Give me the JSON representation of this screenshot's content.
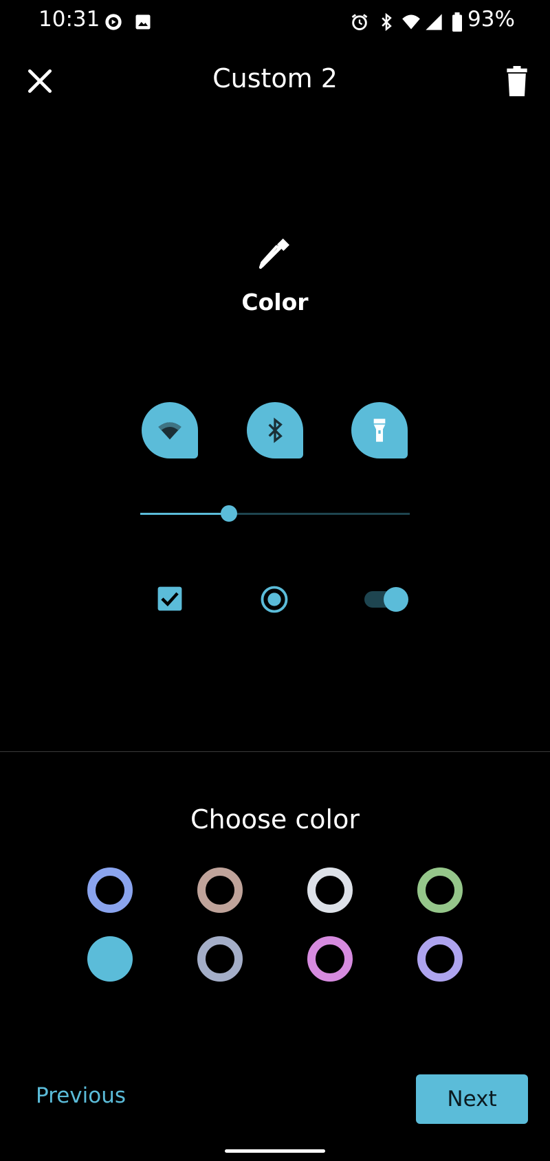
{
  "status_bar": {
    "time": "10:31",
    "battery_percent": "93%",
    "icons": [
      "play-circle-icon",
      "image-icon",
      "alarm-icon",
      "bluetooth-icon",
      "wifi-icon",
      "signal-icon",
      "battery-icon"
    ]
  },
  "app_bar": {
    "title": "Custom 2",
    "close_icon": "close-icon",
    "delete_icon": "delete-icon"
  },
  "section": {
    "icon": "color-dropper-icon",
    "label": "Color"
  },
  "preview": {
    "tiles": [
      "wifi-icon",
      "bluetooth-icon",
      "flashlight-icon"
    ],
    "slider_value": 0.33,
    "checkbox_checked": true,
    "radio_selected": true,
    "toggle_on": true
  },
  "choose": {
    "title": "Choose color",
    "swatches": [
      {
        "color": "#8aa4ee",
        "selected": false
      },
      {
        "color": "#bfa39a",
        "selected": false
      },
      {
        "color": "#dde1e8",
        "selected": false
      },
      {
        "color": "#95c68a",
        "selected": false
      },
      {
        "color": "#5bbcd9",
        "selected": true
      },
      {
        "color": "#a4aec8",
        "selected": false
      },
      {
        "color": "#d68bdf",
        "selected": false
      },
      {
        "color": "#aea4ef",
        "selected": false
      }
    ]
  },
  "footer": {
    "previous_label": "Previous",
    "next_label": "Next"
  },
  "colors": {
    "accent": "#5bbcd9",
    "background": "#000000"
  }
}
